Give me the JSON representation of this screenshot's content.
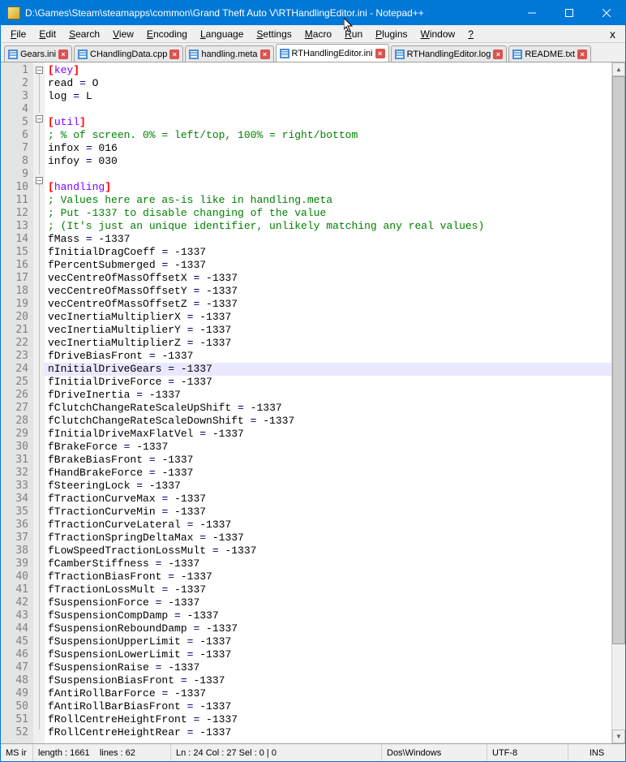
{
  "window": {
    "title": "D:\\Games\\Steam\\steamapps\\common\\Grand Theft Auto V\\RTHandlingEditor.ini - Notepad++"
  },
  "menu": {
    "items": [
      "File",
      "Edit",
      "Search",
      "View",
      "Encoding",
      "Language",
      "Settings",
      "Macro",
      "Run",
      "Plugins",
      "Window",
      "?"
    ]
  },
  "tabs": [
    {
      "label": "Gears.ini",
      "active": false
    },
    {
      "label": "CHandlingData.cpp",
      "active": false
    },
    {
      "label": "handling.meta",
      "active": false
    },
    {
      "label": "RTHandlingEditor.ini",
      "active": true
    },
    {
      "label": "RTHandlingEditor.log",
      "active": false
    },
    {
      "label": "README.txt",
      "active": false
    }
  ],
  "code_lines": [
    {
      "n": 1,
      "fold": "box",
      "segs": [
        {
          "c": "br",
          "t": "["
        },
        {
          "c": "sec",
          "t": "key"
        },
        {
          "c": "br",
          "t": "]"
        }
      ]
    },
    {
      "n": 2,
      "fold": "line",
      "segs": [
        {
          "t": "read "
        },
        {
          "c": "eq",
          "t": "="
        },
        {
          "t": " O"
        }
      ]
    },
    {
      "n": 3,
      "fold": "line",
      "segs": [
        {
          "t": "log "
        },
        {
          "c": "eq",
          "t": "="
        },
        {
          "t": " L"
        }
      ]
    },
    {
      "n": 4,
      "fold": "line",
      "segs": []
    },
    {
      "n": 5,
      "fold": "box",
      "segs": [
        {
          "c": "br",
          "t": "["
        },
        {
          "c": "sec",
          "t": "util"
        },
        {
          "c": "br",
          "t": "]"
        }
      ]
    },
    {
      "n": 6,
      "fold": "line",
      "segs": [
        {
          "c": "cm",
          "t": "; % of screen. 0% = left/top, 100% = right/bottom"
        }
      ]
    },
    {
      "n": 7,
      "fold": "line",
      "segs": [
        {
          "t": "infox "
        },
        {
          "c": "eq",
          "t": "="
        },
        {
          "t": " 016"
        }
      ]
    },
    {
      "n": 8,
      "fold": "line",
      "segs": [
        {
          "t": "infoy "
        },
        {
          "c": "eq",
          "t": "="
        },
        {
          "t": " 030"
        }
      ]
    },
    {
      "n": 9,
      "fold": "line",
      "segs": []
    },
    {
      "n": 10,
      "fold": "box",
      "segs": [
        {
          "c": "br",
          "t": "["
        },
        {
          "c": "sec",
          "t": "handling"
        },
        {
          "c": "br",
          "t": "]"
        }
      ]
    },
    {
      "n": 11,
      "fold": "line",
      "segs": [
        {
          "c": "cm",
          "t": "; Values here are as-is like in handling.meta"
        }
      ]
    },
    {
      "n": 12,
      "fold": "line",
      "segs": [
        {
          "c": "cm",
          "t": "; Put -1337 to disable changing of the value"
        }
      ]
    },
    {
      "n": 13,
      "fold": "line",
      "segs": [
        {
          "c": "cm",
          "t": "; (It's just an unique identifier, unlikely matching any real values)"
        }
      ]
    },
    {
      "n": 14,
      "fold": "line",
      "segs": [
        {
          "t": "fMass "
        },
        {
          "c": "eq",
          "t": "="
        },
        {
          "t": " -1337"
        }
      ]
    },
    {
      "n": 15,
      "fold": "line",
      "segs": [
        {
          "t": "fInitialDragCoeff "
        },
        {
          "c": "eq",
          "t": "="
        },
        {
          "t": " -1337"
        }
      ]
    },
    {
      "n": 16,
      "fold": "line",
      "segs": [
        {
          "t": "fPercentSubmerged "
        },
        {
          "c": "eq",
          "t": "="
        },
        {
          "t": " -1337"
        }
      ]
    },
    {
      "n": 17,
      "fold": "line",
      "segs": [
        {
          "t": "vecCentreOfMassOffsetX "
        },
        {
          "c": "eq",
          "t": "="
        },
        {
          "t": " -1337"
        }
      ]
    },
    {
      "n": 18,
      "fold": "line",
      "segs": [
        {
          "t": "vecCentreOfMassOffsetY "
        },
        {
          "c": "eq",
          "t": "="
        },
        {
          "t": " -1337"
        }
      ]
    },
    {
      "n": 19,
      "fold": "line",
      "segs": [
        {
          "t": "vecCentreOfMassOffsetZ "
        },
        {
          "c": "eq",
          "t": "="
        },
        {
          "t": " -1337"
        }
      ]
    },
    {
      "n": 20,
      "fold": "line",
      "segs": [
        {
          "t": "vecInertiaMultiplierX "
        },
        {
          "c": "eq",
          "t": "="
        },
        {
          "t": " -1337"
        }
      ]
    },
    {
      "n": 21,
      "fold": "line",
      "segs": [
        {
          "t": "vecInertiaMultiplierY "
        },
        {
          "c": "eq",
          "t": "="
        },
        {
          "t": " -1337"
        }
      ]
    },
    {
      "n": 22,
      "fold": "line",
      "segs": [
        {
          "t": "vecInertiaMultiplierZ "
        },
        {
          "c": "eq",
          "t": "="
        },
        {
          "t": " -1337"
        }
      ]
    },
    {
      "n": 23,
      "fold": "line",
      "segs": [
        {
          "t": "fDriveBiasFront "
        },
        {
          "c": "eq",
          "t": "="
        },
        {
          "t": " -1337"
        }
      ]
    },
    {
      "n": 24,
      "fold": "line",
      "hl": true,
      "segs": [
        {
          "t": "nInitialDriveGears "
        },
        {
          "c": "eq",
          "t": "="
        },
        {
          "t": " -1337"
        }
      ]
    },
    {
      "n": 25,
      "fold": "line",
      "segs": [
        {
          "t": "fInitialDriveForce "
        },
        {
          "c": "eq",
          "t": "="
        },
        {
          "t": " -1337"
        }
      ]
    },
    {
      "n": 26,
      "fold": "line",
      "segs": [
        {
          "t": "fDriveInertia "
        },
        {
          "c": "eq",
          "t": "="
        },
        {
          "t": " -1337"
        }
      ]
    },
    {
      "n": 27,
      "fold": "line",
      "segs": [
        {
          "t": "fClutchChangeRateScaleUpShift "
        },
        {
          "c": "eq",
          "t": "="
        },
        {
          "t": " -1337"
        }
      ]
    },
    {
      "n": 28,
      "fold": "line",
      "segs": [
        {
          "t": "fClutchChangeRateScaleDownShift "
        },
        {
          "c": "eq",
          "t": "="
        },
        {
          "t": " -1337"
        }
      ]
    },
    {
      "n": 29,
      "fold": "line",
      "segs": [
        {
          "t": "fInitialDriveMaxFlatVel "
        },
        {
          "c": "eq",
          "t": "="
        },
        {
          "t": " -1337"
        }
      ]
    },
    {
      "n": 30,
      "fold": "line",
      "segs": [
        {
          "t": "fBrakeForce "
        },
        {
          "c": "eq",
          "t": "="
        },
        {
          "t": " -1337"
        }
      ]
    },
    {
      "n": 31,
      "fold": "line",
      "segs": [
        {
          "t": "fBrakeBiasFront "
        },
        {
          "c": "eq",
          "t": "="
        },
        {
          "t": " -1337"
        }
      ]
    },
    {
      "n": 32,
      "fold": "line",
      "segs": [
        {
          "t": "fHandBrakeForce "
        },
        {
          "c": "eq",
          "t": "="
        },
        {
          "t": " -1337"
        }
      ]
    },
    {
      "n": 33,
      "fold": "line",
      "segs": [
        {
          "t": "fSteeringLock "
        },
        {
          "c": "eq",
          "t": "="
        },
        {
          "t": " -1337"
        }
      ]
    },
    {
      "n": 34,
      "fold": "line",
      "segs": [
        {
          "t": "fTractionCurveMax "
        },
        {
          "c": "eq",
          "t": "="
        },
        {
          "t": " -1337"
        }
      ]
    },
    {
      "n": 35,
      "fold": "line",
      "segs": [
        {
          "t": "fTractionCurveMin "
        },
        {
          "c": "eq",
          "t": "="
        },
        {
          "t": " -1337"
        }
      ]
    },
    {
      "n": 36,
      "fold": "line",
      "segs": [
        {
          "t": "fTractionCurveLateral "
        },
        {
          "c": "eq",
          "t": "="
        },
        {
          "t": " -1337"
        }
      ]
    },
    {
      "n": 37,
      "fold": "line",
      "segs": [
        {
          "t": "fTractionSpringDeltaMax "
        },
        {
          "c": "eq",
          "t": "="
        },
        {
          "t": " -1337"
        }
      ]
    },
    {
      "n": 38,
      "fold": "line",
      "segs": [
        {
          "t": "fLowSpeedTractionLossMult "
        },
        {
          "c": "eq",
          "t": "="
        },
        {
          "t": " -1337"
        }
      ]
    },
    {
      "n": 39,
      "fold": "line",
      "segs": [
        {
          "t": "fCamberStiffness "
        },
        {
          "c": "eq",
          "t": "="
        },
        {
          "t": " -1337"
        }
      ]
    },
    {
      "n": 40,
      "fold": "line",
      "segs": [
        {
          "t": "fTractionBiasFront "
        },
        {
          "c": "eq",
          "t": "="
        },
        {
          "t": " -1337"
        }
      ]
    },
    {
      "n": 41,
      "fold": "line",
      "segs": [
        {
          "t": "fTractionLossMult "
        },
        {
          "c": "eq",
          "t": "="
        },
        {
          "t": " -1337"
        }
      ]
    },
    {
      "n": 42,
      "fold": "line",
      "segs": [
        {
          "t": "fSuspensionForce "
        },
        {
          "c": "eq",
          "t": "="
        },
        {
          "t": " -1337"
        }
      ]
    },
    {
      "n": 43,
      "fold": "line",
      "segs": [
        {
          "t": "fSuspensionCompDamp "
        },
        {
          "c": "eq",
          "t": "="
        },
        {
          "t": " -1337"
        }
      ]
    },
    {
      "n": 44,
      "fold": "line",
      "segs": [
        {
          "t": "fSuspensionReboundDamp "
        },
        {
          "c": "eq",
          "t": "="
        },
        {
          "t": " -1337"
        }
      ]
    },
    {
      "n": 45,
      "fold": "line",
      "segs": [
        {
          "t": "fSuspensionUpperLimit "
        },
        {
          "c": "eq",
          "t": "="
        },
        {
          "t": " -1337"
        }
      ]
    },
    {
      "n": 46,
      "fold": "line",
      "segs": [
        {
          "t": "fSuspensionLowerLimit "
        },
        {
          "c": "eq",
          "t": "="
        },
        {
          "t": " -1337"
        }
      ]
    },
    {
      "n": 47,
      "fold": "line",
      "segs": [
        {
          "t": "fSuspensionRaise "
        },
        {
          "c": "eq",
          "t": "="
        },
        {
          "t": " -1337"
        }
      ]
    },
    {
      "n": 48,
      "fold": "line",
      "segs": [
        {
          "t": "fSuspensionBiasFront "
        },
        {
          "c": "eq",
          "t": "="
        },
        {
          "t": " -1337"
        }
      ]
    },
    {
      "n": 49,
      "fold": "line",
      "segs": [
        {
          "t": "fAntiRollBarForce "
        },
        {
          "c": "eq",
          "t": "="
        },
        {
          "t": " -1337"
        }
      ]
    },
    {
      "n": 50,
      "fold": "line",
      "segs": [
        {
          "t": "fAntiRollBarBiasFront "
        },
        {
          "c": "eq",
          "t": "="
        },
        {
          "t": " -1337"
        }
      ]
    },
    {
      "n": 51,
      "fold": "line",
      "segs": [
        {
          "t": "fRollCentreHeightFront "
        },
        {
          "c": "eq",
          "t": "="
        },
        {
          "t": " -1337"
        }
      ]
    },
    {
      "n": 52,
      "fold": "line",
      "segs": [
        {
          "t": "fRollCentreHeightRear "
        },
        {
          "c": "eq",
          "t": "="
        },
        {
          "t": " -1337"
        }
      ]
    }
  ],
  "statusbar": {
    "filetype": "MS ir",
    "length": "length : 1661",
    "lines": "lines : 62",
    "pos": "Ln : 24    Col : 27    Sel : 0 | 0",
    "eol": "Dos\\Windows",
    "encoding": "UTF-8",
    "mode": "INS"
  }
}
